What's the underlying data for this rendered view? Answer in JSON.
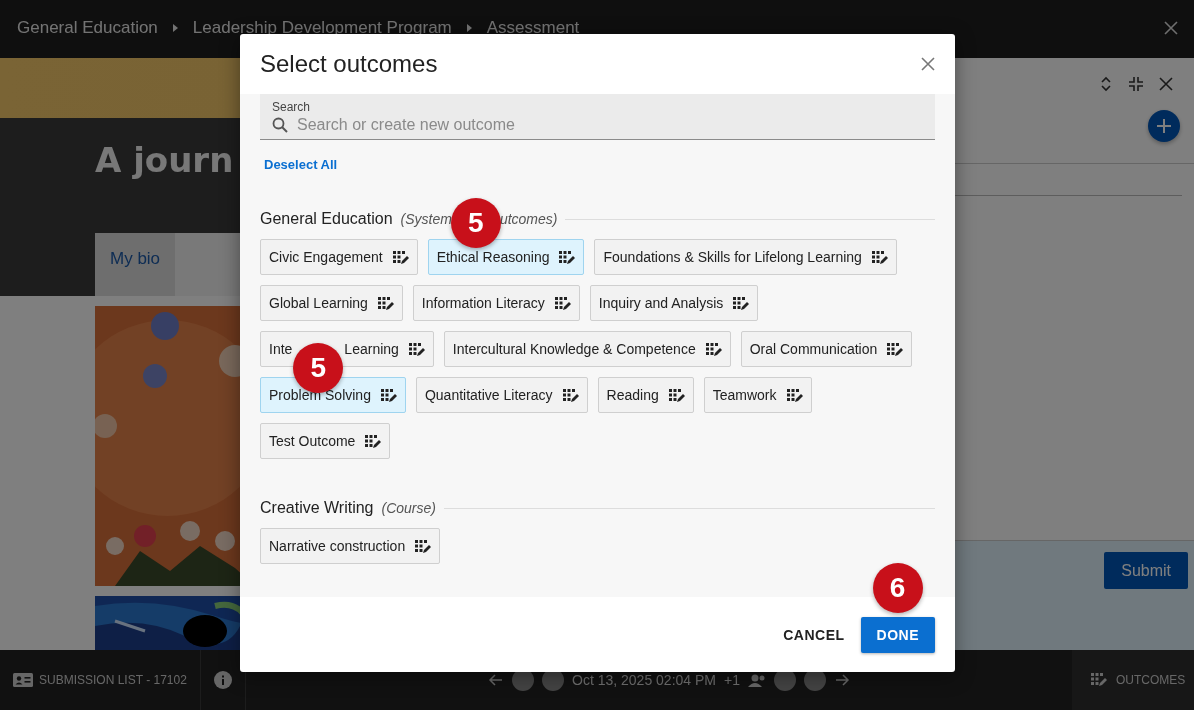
{
  "breadcrumb": [
    {
      "label": "General Education"
    },
    {
      "label": "Leadership Development Program"
    },
    {
      "label": "Assessment"
    }
  ],
  "page": {
    "title": "A journ",
    "tabs": [
      {
        "label": "My bio"
      }
    ]
  },
  "panel": {
    "submit": "Submit"
  },
  "bottom_bar": {
    "submission_list": "SUBMISSION LIST - 17102",
    "date": "Oct 13, 2025 02:04 PM",
    "extra_count": "+1",
    "outcomes": "OUTCOMES"
  },
  "modal": {
    "title": "Select outcomes",
    "search": {
      "label": "Search",
      "placeholder": "Search or create new outcome"
    },
    "deselect_all": "Deselect All",
    "groups": [
      {
        "name": "General Education",
        "scope_parts": [
          "(System",
          "utcomes)"
        ],
        "callout": "5",
        "outcomes": [
          {
            "label_parts": [
              "Civic Engagement"
            ],
            "selected": false
          },
          {
            "label_parts": [
              "Ethical Reasoning"
            ],
            "selected": true
          },
          {
            "label_parts": [
              "Foundations & Skills for Lifelong Learning"
            ],
            "selected": false
          },
          {
            "label_parts": [
              "Global Learning"
            ],
            "selected": false
          },
          {
            "label_parts": [
              "Information Literacy"
            ],
            "selected": false
          },
          {
            "label_parts": [
              "Inquiry and Analysis"
            ],
            "selected": false
          },
          {
            "label_parts": [
              "Inte",
              "Learning"
            ],
            "selected": false,
            "callout": "5"
          },
          {
            "label_parts": [
              "Intercultural Knowledge & Competence"
            ],
            "selected": false
          },
          {
            "label_parts": [
              "Oral Communication"
            ],
            "selected": false
          },
          {
            "label_parts": [
              "Problem Solving"
            ],
            "selected": true
          },
          {
            "label_parts": [
              "Quantitative Literacy"
            ],
            "selected": false
          },
          {
            "label_parts": [
              "Reading"
            ],
            "selected": false
          },
          {
            "label_parts": [
              "Teamwork"
            ],
            "selected": false
          },
          {
            "label_parts": [
              "Test Outcome"
            ],
            "selected": false
          }
        ]
      },
      {
        "name": "Creative Writing",
        "scope_parts": [
          "(Course)"
        ],
        "outcomes": [
          {
            "label_parts": [
              "Narrative construction"
            ],
            "selected": false
          }
        ]
      }
    ],
    "cancel": "CANCEL",
    "done": {
      "label": "DONE",
      "callout": "6"
    }
  }
}
